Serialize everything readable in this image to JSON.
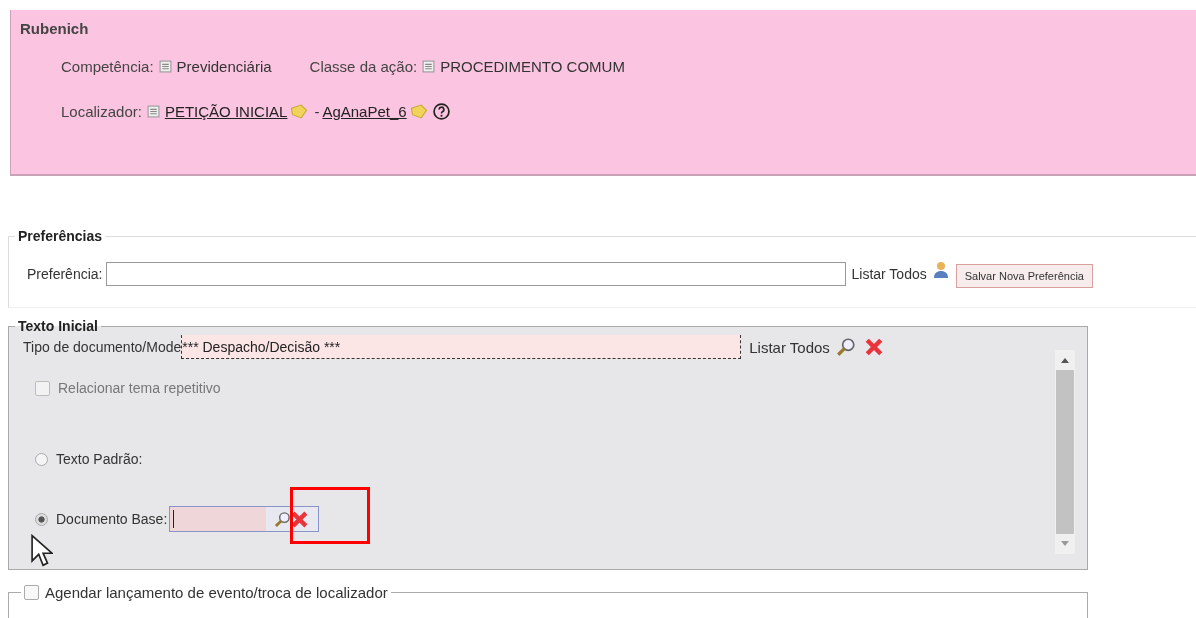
{
  "header": {
    "name": "Rubenich",
    "fields": [
      {
        "label": "Competência:",
        "value": "Previdenciária"
      },
      {
        "label": "Classe da ação:",
        "value": "PROCEDIMENTO COMUM"
      }
    ],
    "localizador": {
      "label": "Localizador:",
      "links": [
        "PETIÇÃO INICIAL ",
        "AgAnaPet_6 "
      ],
      "separator": "-"
    }
  },
  "preferencias": {
    "legend": "Preferências",
    "label": "Preferência:",
    "list_link": "Listar Todos",
    "save_button": "Salvar Nova Preferência"
  },
  "texto_inicial": {
    "legend": "Texto Inicial",
    "tipo_label": "Tipo de documento/Mode",
    "tipo_value": "*** Despacho/Decisão ***",
    "list_link": "Listar Todos",
    "checkbox": {
      "label": "Relacionar tema repetitivo",
      "checked": false,
      "disabled": true
    },
    "options": [
      {
        "label": "Texto Padrão:",
        "selected": false,
        "kind": "plain"
      },
      {
        "label": "Documento Base:",
        "selected": true,
        "kind": "field"
      }
    ]
  },
  "agendar": {
    "label": "Agendar lançamento de evento/troca de localizador",
    "checked": false
  }
}
